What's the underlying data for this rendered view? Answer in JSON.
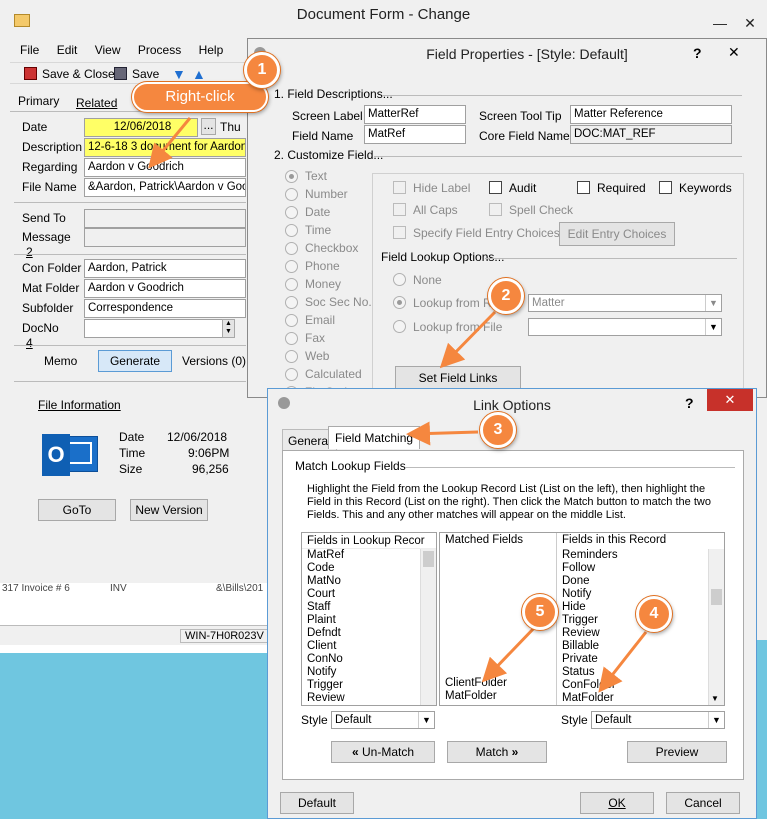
{
  "doc_form": {
    "title": "Document Form - Change",
    "menu": [
      "File",
      "Edit",
      "View",
      "Process",
      "Help"
    ],
    "toolbar": {
      "save_close": "Save & Close",
      "save": "Save"
    },
    "tabs": [
      "Primary",
      "Related"
    ],
    "fields": {
      "date_label": "Date",
      "date_value": "12/06/2018",
      "date_day": "Thu",
      "description_label": "Description",
      "description_value": "12-6-18 3 document for Aardon",
      "regarding_label": "Regarding",
      "regarding_value": "Aardon v Goodrich",
      "filename_label": "File Name",
      "filename_value": "&Aardon, Patrick\\Aardon v Goodrich",
      "sendto_label": "Send To",
      "message_label": "Message",
      "section2": "2",
      "confolder_label": "Con Folder",
      "confolder_value": "Aardon, Patrick",
      "matfolder_label": "Mat Folder",
      "matfolder_value": "Aardon v Goodrich",
      "subfolder_label": "Subfolder",
      "subfolder_value": "Correspondence",
      "docno_label": "DocNo",
      "section4": "4",
      "memo_label": "Memo",
      "generate": "Generate",
      "versions": "Versions (0)"
    },
    "file_info": {
      "heading": "File Information",
      "date_label": "Date",
      "date_value": "12/06/2018",
      "time_label": "Time",
      "time_value": "9:06PM",
      "size_label": "Size",
      "size_value": "96,256",
      "goto": "GoTo",
      "new_version": "New Version"
    },
    "bg_row": {
      "left": "317 Invoice # 6",
      "mid": "INV",
      "right": "&\\Bills\\201"
    },
    "status": "WIN-7H0R023V"
  },
  "field_props": {
    "title": "Field Properties - [Style: Default]",
    "help": "?",
    "sec1": "1. Field Descriptions...",
    "screen_label_lbl": "Screen Label",
    "screen_label": "MatterRef",
    "tooltip_lbl": "Screen Tool Tip",
    "tooltip": "Matter Reference",
    "field_name_lbl": "Field Name",
    "field_name": "MatRef",
    "core_lbl": "Core Field Name",
    "core": "DOC:MAT_REF",
    "sec2": "2. Customize Field...",
    "types": [
      "Text",
      "Number",
      "Date",
      "Time",
      "Checkbox",
      "Phone",
      "Money",
      "Soc Sec No.",
      "Email",
      "Fax",
      "Web",
      "Calculated",
      "Zip Code"
    ],
    "hide_label": "Hide Label",
    "audit": "Audit",
    "required": "Required",
    "keywords": "Keywords",
    "all_caps": "All Caps",
    "spell_check": "Spell Check",
    "specify_choices": "Specify Field Entry Choices",
    "edit_choices": "Edit Entry Choices",
    "lookup_heading": "Field Lookup Options...",
    "none": "None",
    "lookup_from_r": "Lookup from R",
    "lookup_from_f": "Lookup from File",
    "lookup_value": "Matter",
    "set_links": "Set Field Links"
  },
  "link_options": {
    "title": "Link Options",
    "help": "?",
    "tabs": [
      "General",
      "Field Matching"
    ],
    "group": "Match Lookup Fields",
    "instructions": "Highlight the Field from the Lookup Record List (List on the left), then highlight the Field in this Record (List on the right). Then click the Match button to match the two Fields. This and any other matches will appear on the middle List.",
    "lookup_header": "Fields in Lookup Recor",
    "lookup_fields": [
      "MatRef",
      "Code",
      "MatNo",
      "Court",
      "Staff",
      "Plaint",
      "Defndt",
      "Client",
      "ConNo",
      "Notify",
      "Trigger",
      "Review"
    ],
    "matched_header": "Matched Fields",
    "matched": [
      "ClientFolder",
      "MatFolder"
    ],
    "record_header": "Fields in this Record",
    "record_fields": [
      "Reminders",
      "Follow",
      "Done",
      "Notify",
      "Hide",
      "Trigger",
      "Review",
      "Billable",
      "Private",
      "Status",
      "ConFolder",
      "MatFolder"
    ],
    "style_label": "Style",
    "style_value": "Default",
    "unmatch": "Un-Match",
    "match": "Match",
    "preview": "Preview",
    "default": "Default",
    "ok": "OK",
    "cancel": "Cancel"
  },
  "callouts": {
    "c1": "1",
    "c2": "2",
    "c3": "3",
    "c4": "4",
    "c5": "5",
    "right_click": "Right-click"
  },
  "colors": {
    "accent": "#f5873f",
    "close": "#c7312a",
    "highlight": "#ffff66"
  }
}
